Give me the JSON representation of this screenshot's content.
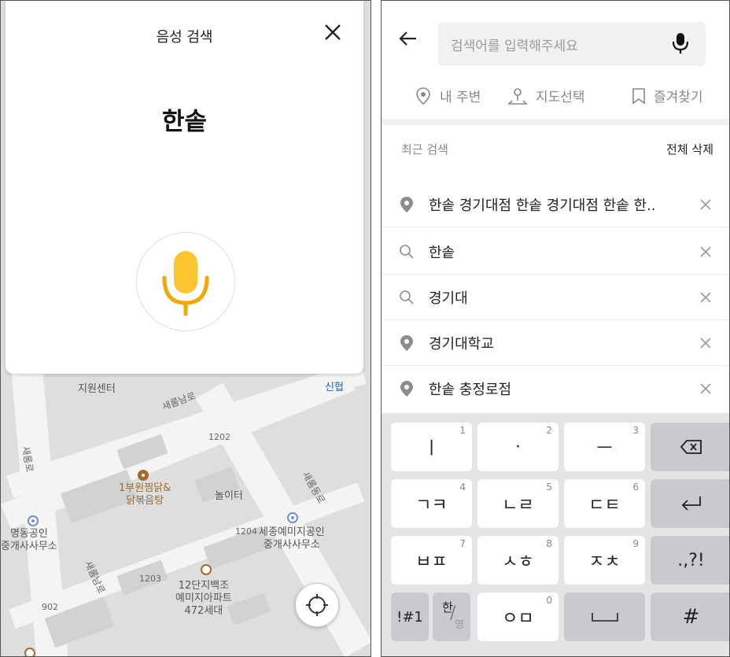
{
  "voice": {
    "title": "음성 검색",
    "result": "한솥"
  },
  "map": {
    "labels": {
      "jiwon": "지원센터",
      "sejong_namro": "새롬남로",
      "shinhyup": "신협",
      "num_1202": "1202",
      "sejong_ro": "새롬로",
      "restaurant": "1부원찜닭&\n닭볶음탕",
      "playground": "놀이터",
      "sejong_dongro": "새롬동로",
      "myeongdong": "명동공인\n중개사사무소",
      "num_1204": "1204",
      "sejong_yemiji": "세종예미지공인\n중개사사무소",
      "num_1203": "1203",
      "apt": "12단지백조\n예미지아파트\n472세대",
      "num_902": "902",
      "sejong_namro2": "새롬남로"
    }
  },
  "search": {
    "placeholder": "검색어를 입력해주세요",
    "quick": [
      "내 주변",
      "지도선택",
      "즐겨찾기"
    ],
    "recent_title": "최근 검색",
    "delete_all": "전체 삭제",
    "history": [
      {
        "type": "place",
        "text": "한솥 경기대점 한솥 경기대점 한솥 한.."
      },
      {
        "type": "query",
        "text": "한솥"
      },
      {
        "type": "query",
        "text": "경기대"
      },
      {
        "type": "place",
        "text": "경기대학교"
      },
      {
        "type": "place",
        "text": "한솥 충정로점"
      }
    ]
  },
  "keyboard": {
    "rows": [
      [
        {
          "label": "ㅣ",
          "num": "1"
        },
        {
          "label": "·",
          "num": "2"
        },
        {
          "label": "ㅡ",
          "num": "3"
        },
        {
          "label": "backspace-icon",
          "num": ""
        }
      ],
      [
        {
          "label": "ㄱㅋ",
          "num": "4"
        },
        {
          "label": "ㄴㄹ",
          "num": "5"
        },
        {
          "label": "ㄷㅌ",
          "num": "6"
        },
        {
          "label": "enter-icon",
          "num": ""
        }
      ],
      [
        {
          "label": "ㅂㅍ",
          "num": "7"
        },
        {
          "label": "ㅅㅎ",
          "num": "8"
        },
        {
          "label": "ㅈㅊ",
          "num": "9"
        },
        {
          "label": ".,?!",
          "num": ""
        }
      ],
      [
        {
          "label": "!#1",
          "num": ""
        },
        {
          "label": "한/영",
          "num": ""
        },
        {
          "label": "ㅇㅁ",
          "num": "0"
        },
        {
          "label": "space-icon",
          "num": ""
        },
        {
          "label": "#",
          "num": ""
        }
      ]
    ],
    "lang_top": "한",
    "lang_bottom": "영"
  },
  "colors": {
    "accent": "#f3b400",
    "mic_accent": "#fbc52f"
  }
}
